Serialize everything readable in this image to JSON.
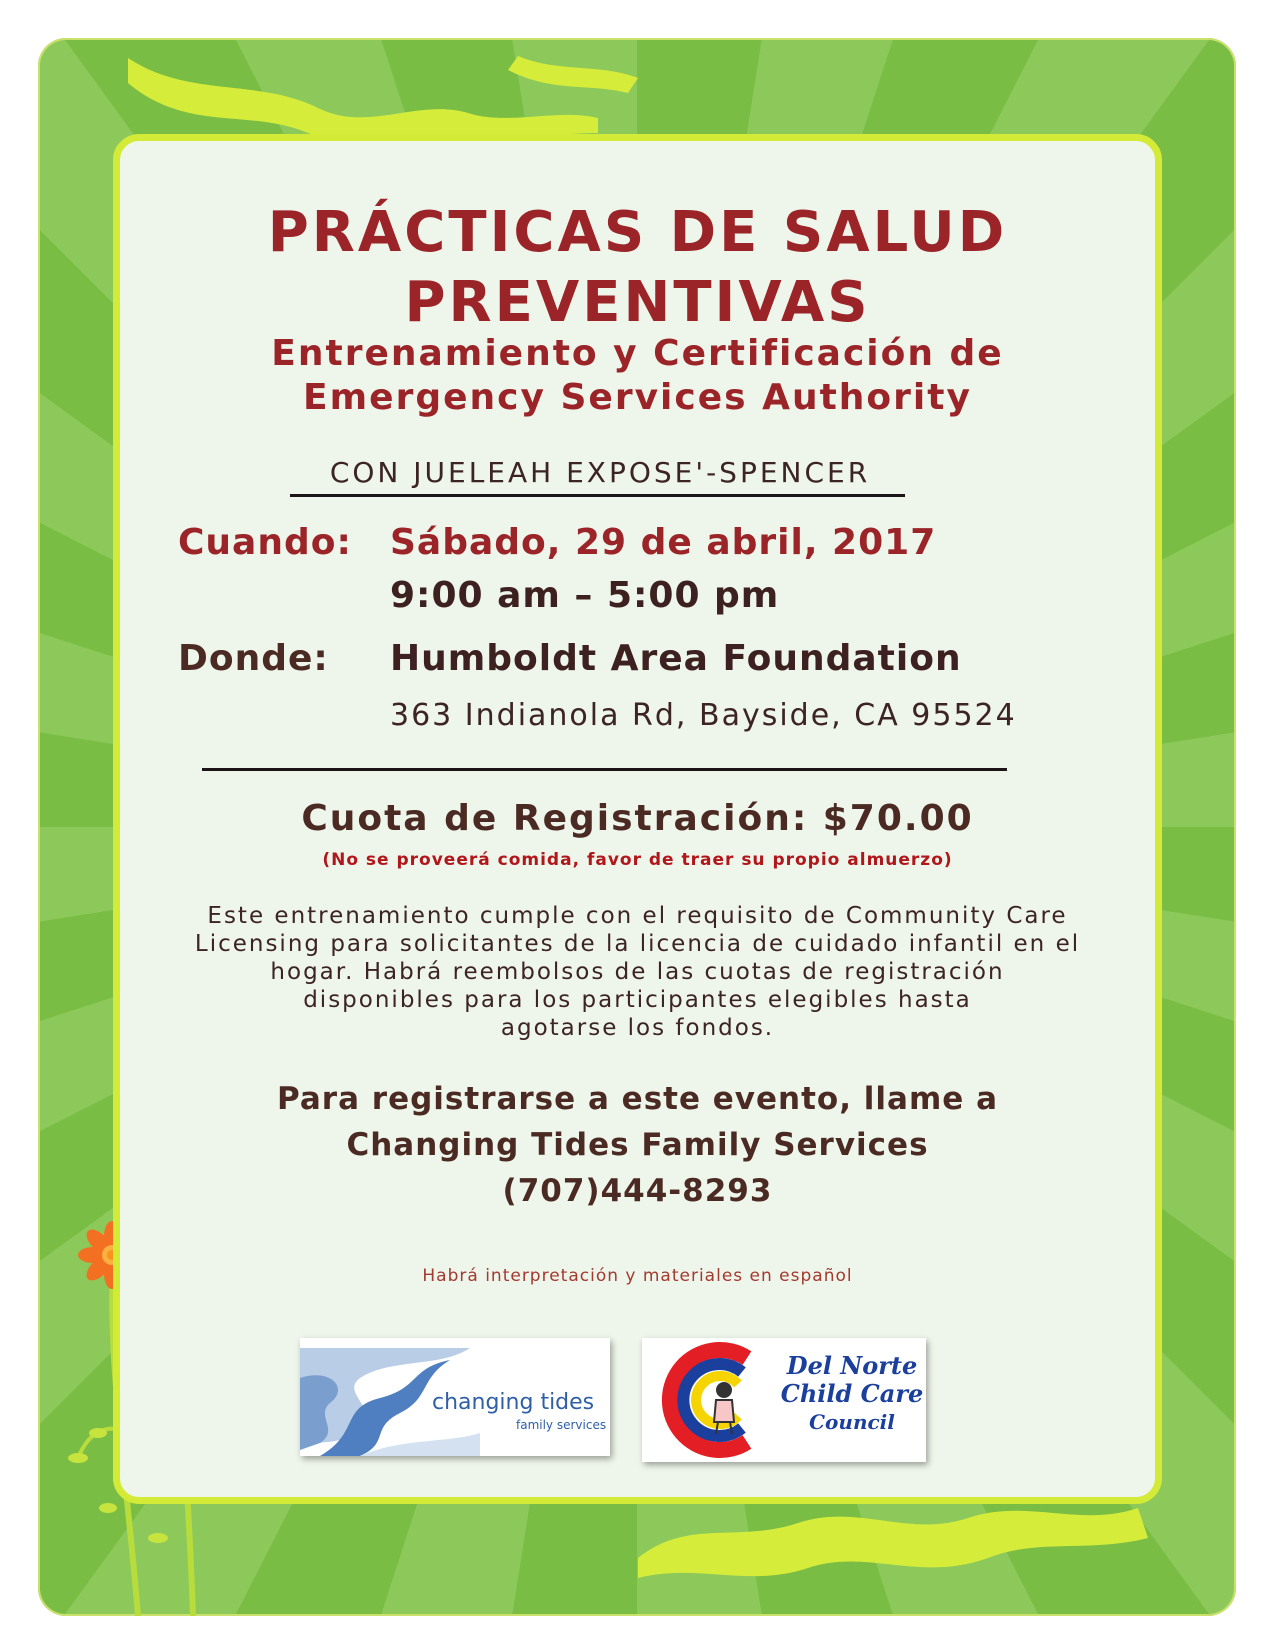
{
  "title": {
    "line1": "PRÁCTICAS DE SALUD",
    "line2": "PREVENTIVAS"
  },
  "subtitle": {
    "line1": "Entrenamiento y Certificación de",
    "line2": "Emergency Services Authority"
  },
  "presenter": "CON JUELEAH EXPOSE'-SPENCER",
  "when": {
    "label": "Cuando:",
    "date": "Sábado, 29 de abril, 2017",
    "time": "9:00 am – 5:00 pm"
  },
  "where": {
    "label": "Donde:",
    "venue": "Humboldt Area Foundation",
    "address": "363 Indianola Rd, Bayside, CA 95524"
  },
  "fee": {
    "text": "Cuota de Registración: $70.00",
    "note": "(No se proveerá comida, favor de traer su propio almuerzo)"
  },
  "description": [
    "Este entrenamiento cumple con el requisito de Community Care",
    "Licensing para solicitantes de la licencia de cuidado infantil en el",
    "hogar. Habrá reembolsos de las cuotas de registración",
    "disponibles para los participantes elegibles hasta",
    "agotarse los fondos."
  ],
  "register": {
    "line1": "Para registrarse a este evento, llame a",
    "line2": "Changing Tides Family Services",
    "phone": "(707)444-8293"
  },
  "interpretation": "Habrá interpretación y materiales en español",
  "logos": {
    "changing_tides": {
      "name": "changing tides",
      "tagline": "family services"
    },
    "del_norte": {
      "line1": "Del Norte",
      "line2": "Child Care",
      "line3": "Council"
    }
  },
  "colors": {
    "frame_green": "#79bd45",
    "panel_bg": "#eef5ea",
    "panel_border": "#d3ea37",
    "title_red": "#9b2428",
    "text_brown": "#4a2a22",
    "flower_orange": "#f36f21"
  }
}
